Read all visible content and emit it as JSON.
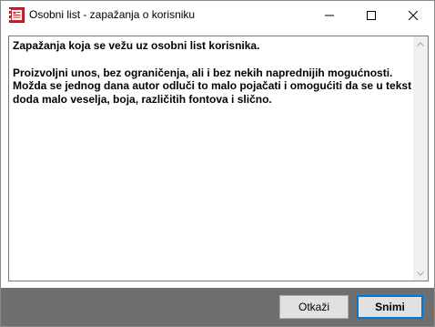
{
  "window": {
    "title": "Osobni list - zapažanja o korisniku",
    "app_icon": "notebook-app-icon",
    "controls": [
      "minimize-icon",
      "maximize-icon",
      "close-icon"
    ]
  },
  "notes": {
    "line1": "Zapažanja koja se vežu uz osobni list korisnika.",
    "line2": "Proizvoljni unos, bez ograničenja, ali i bez nekih naprednijih mogućnosti.",
    "line3": "Možda se jednog dana autor odluči to malo pojačati i omogućiti da se u tekst",
    "line4": "doda malo veselja, boja, različitih fontova i slično."
  },
  "footer": {
    "cancel_label": "Otkaži",
    "save_label": "Snimi"
  },
  "colors": {
    "footer_bg": "#6f6f6f",
    "default_button_border": "#0078d7",
    "app_icon_red": "#c8262f"
  }
}
